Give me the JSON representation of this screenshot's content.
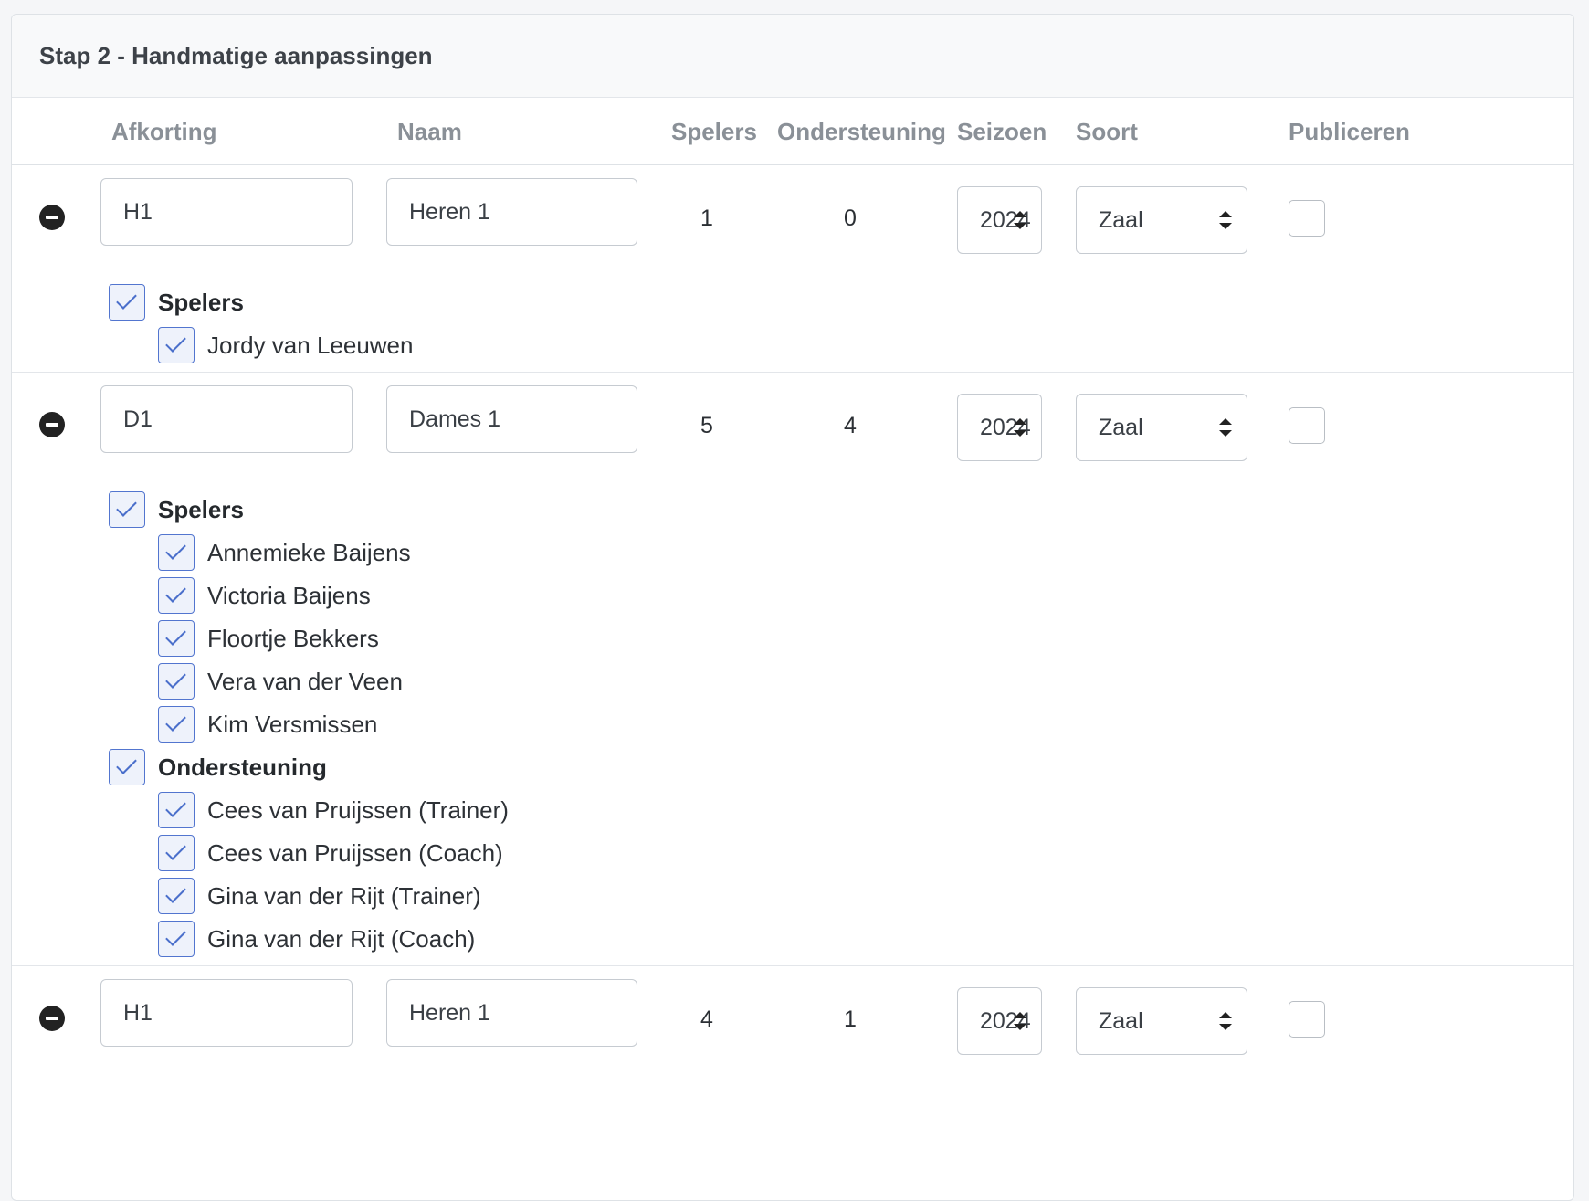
{
  "card": {
    "title": "Stap 2 - Handmatige aanpassingen"
  },
  "columns": {
    "afkorting": "Afkorting",
    "naam": "Naam",
    "spelers": "Spelers",
    "ondersteuning": "Ondersteuning",
    "seizoen": "Seizoen",
    "soort": "Soort",
    "publiceren": "Publiceren"
  },
  "teams": [
    {
      "afkorting": "H1",
      "naam": "Heren 1",
      "spelers": "1",
      "ondersteuning": "0",
      "seizoen": "2024",
      "soort": "Zaal",
      "groups": [
        {
          "label": "Spelers",
          "members": [
            "Jordy van Leeuwen"
          ]
        }
      ]
    },
    {
      "afkorting": "D1",
      "naam": "Dames 1",
      "spelers": "5",
      "ondersteuning": "4",
      "seizoen": "2024",
      "soort": "Zaal",
      "groups": [
        {
          "label": "Spelers",
          "members": [
            "Annemieke Baijens",
            "Victoria Baijens",
            "Floortje Bekkers",
            "Vera van der Veen",
            "Kim Versmissen"
          ]
        },
        {
          "label": "Ondersteuning",
          "members": [
            "Cees van Pruijssen (Trainer)",
            "Cees van Pruijssen (Coach)",
            "Gina van der Rijt (Trainer)",
            "Gina van der Rijt (Coach)"
          ]
        }
      ]
    },
    {
      "afkorting": "H1",
      "naam": "Heren 1",
      "spelers": "4",
      "ondersteuning": "1",
      "seizoen": "2024",
      "soort": "Zaal",
      "groups": []
    }
  ]
}
